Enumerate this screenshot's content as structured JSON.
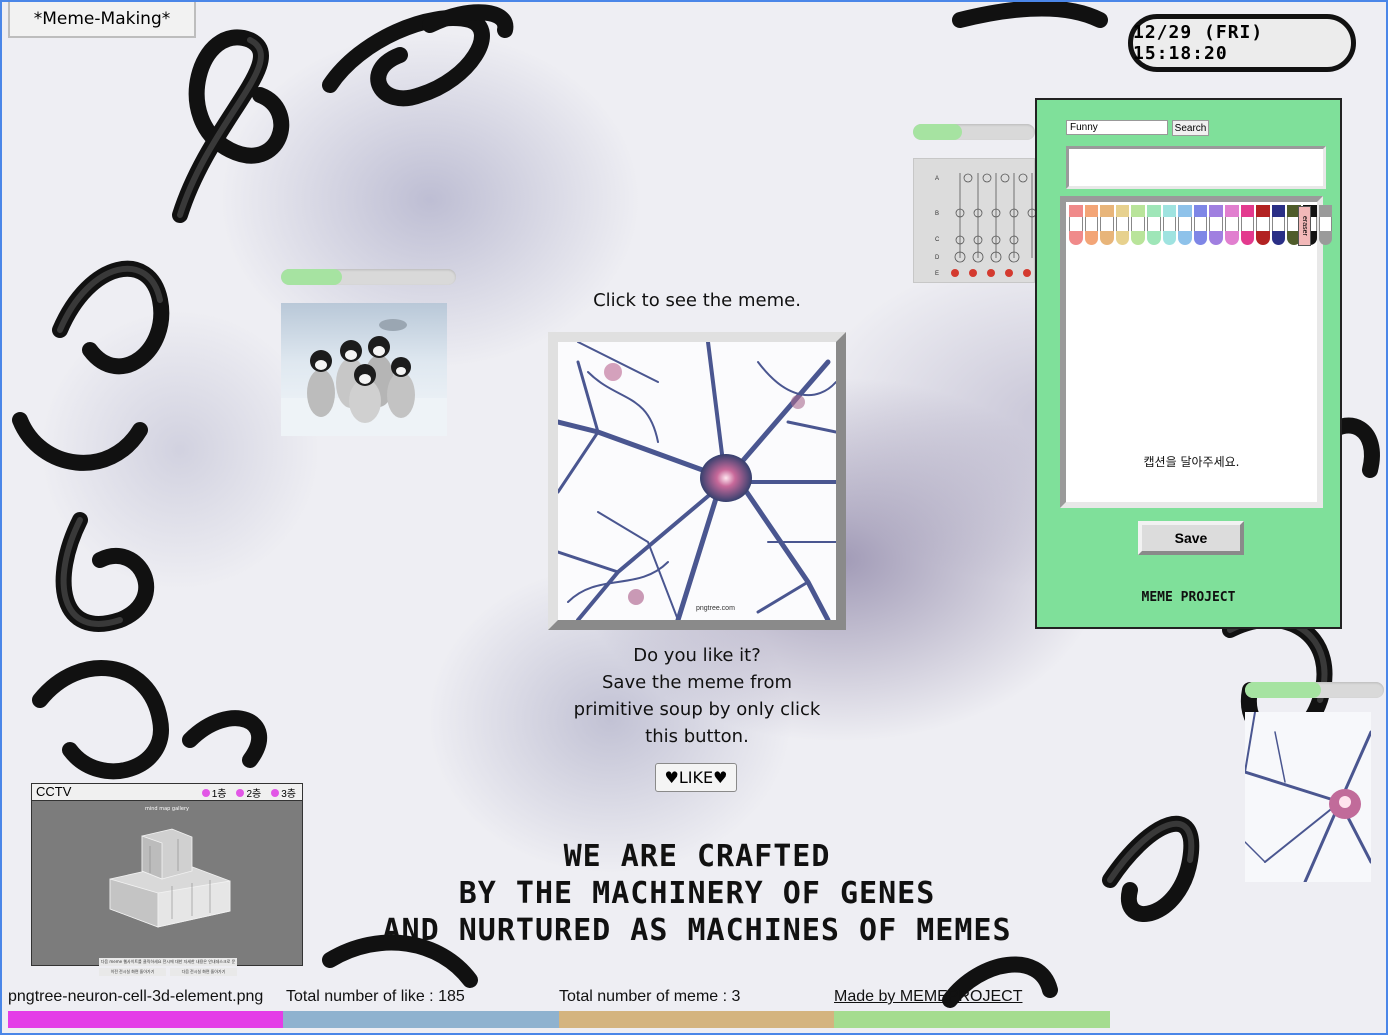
{
  "header": {
    "title": "*Meme-Making*",
    "clock": "12/29 (FRI) 15:18:20"
  },
  "meme": {
    "click_prompt": "Click to see the meme.",
    "like_prompt_lines": [
      "Do you like it?",
      "Save the meme from",
      "primitive soup by only click",
      "this button."
    ],
    "like_button": "♥LIKE♥",
    "image_watermark": "pngtree.com"
  },
  "progress_bars": {
    "penguin": 0.35,
    "mixer": 0.4,
    "neuron_thumb": 0.55
  },
  "mixer": {
    "row_labels": [
      "A",
      "B",
      "C",
      "D",
      "E"
    ]
  },
  "editor": {
    "search_value": "Funny",
    "search_button": "Search",
    "caption_value": "",
    "canvas_caption": "캡션을 달아주세요.",
    "eraser_label": "eraser",
    "save_button": "Save",
    "logo": "MEME PROJECT",
    "palette": [
      "#f08a8a",
      "#f3a577",
      "#e8b57a",
      "#e7d18e",
      "#b9e49a",
      "#9fe6b8",
      "#9fe3e0",
      "#8ec2ea",
      "#7e86e6",
      "#a07fe0",
      "#e17fcf",
      "#e33a8e",
      "#b22222",
      "#2a2f86",
      "#4f5c2a",
      "#111111",
      "#9a9a9a"
    ]
  },
  "cctv": {
    "title": "CCTV",
    "floors": [
      "1층",
      "2층",
      "3층"
    ],
    "floor_dot_color": "#e257e6",
    "screen_title": "mind map gallery",
    "note": "다음 meme 웹사이트를 클릭하세요 전시에 대한 자세한 내용은 안내데스크로 문의 바랍니다",
    "buttons": [
      "이전 전시실 화면 돌아가기",
      "다음 전시실 화면 돌아가기"
    ]
  },
  "tagline": [
    "We are crafted",
    "by the machinery of genes",
    "and nurtured as machines of memes"
  ],
  "footer": {
    "filename": "pngtree-neuron-cell-3d-element.png",
    "total_likes": "Total number of like : 185",
    "total_memes": "Total number of meme : 3",
    "credits": "Made by MEMEPROJECT",
    "colors": [
      "#e43de7",
      "#8fb2cf",
      "#d4b47f",
      "#a5dc8f"
    ]
  }
}
